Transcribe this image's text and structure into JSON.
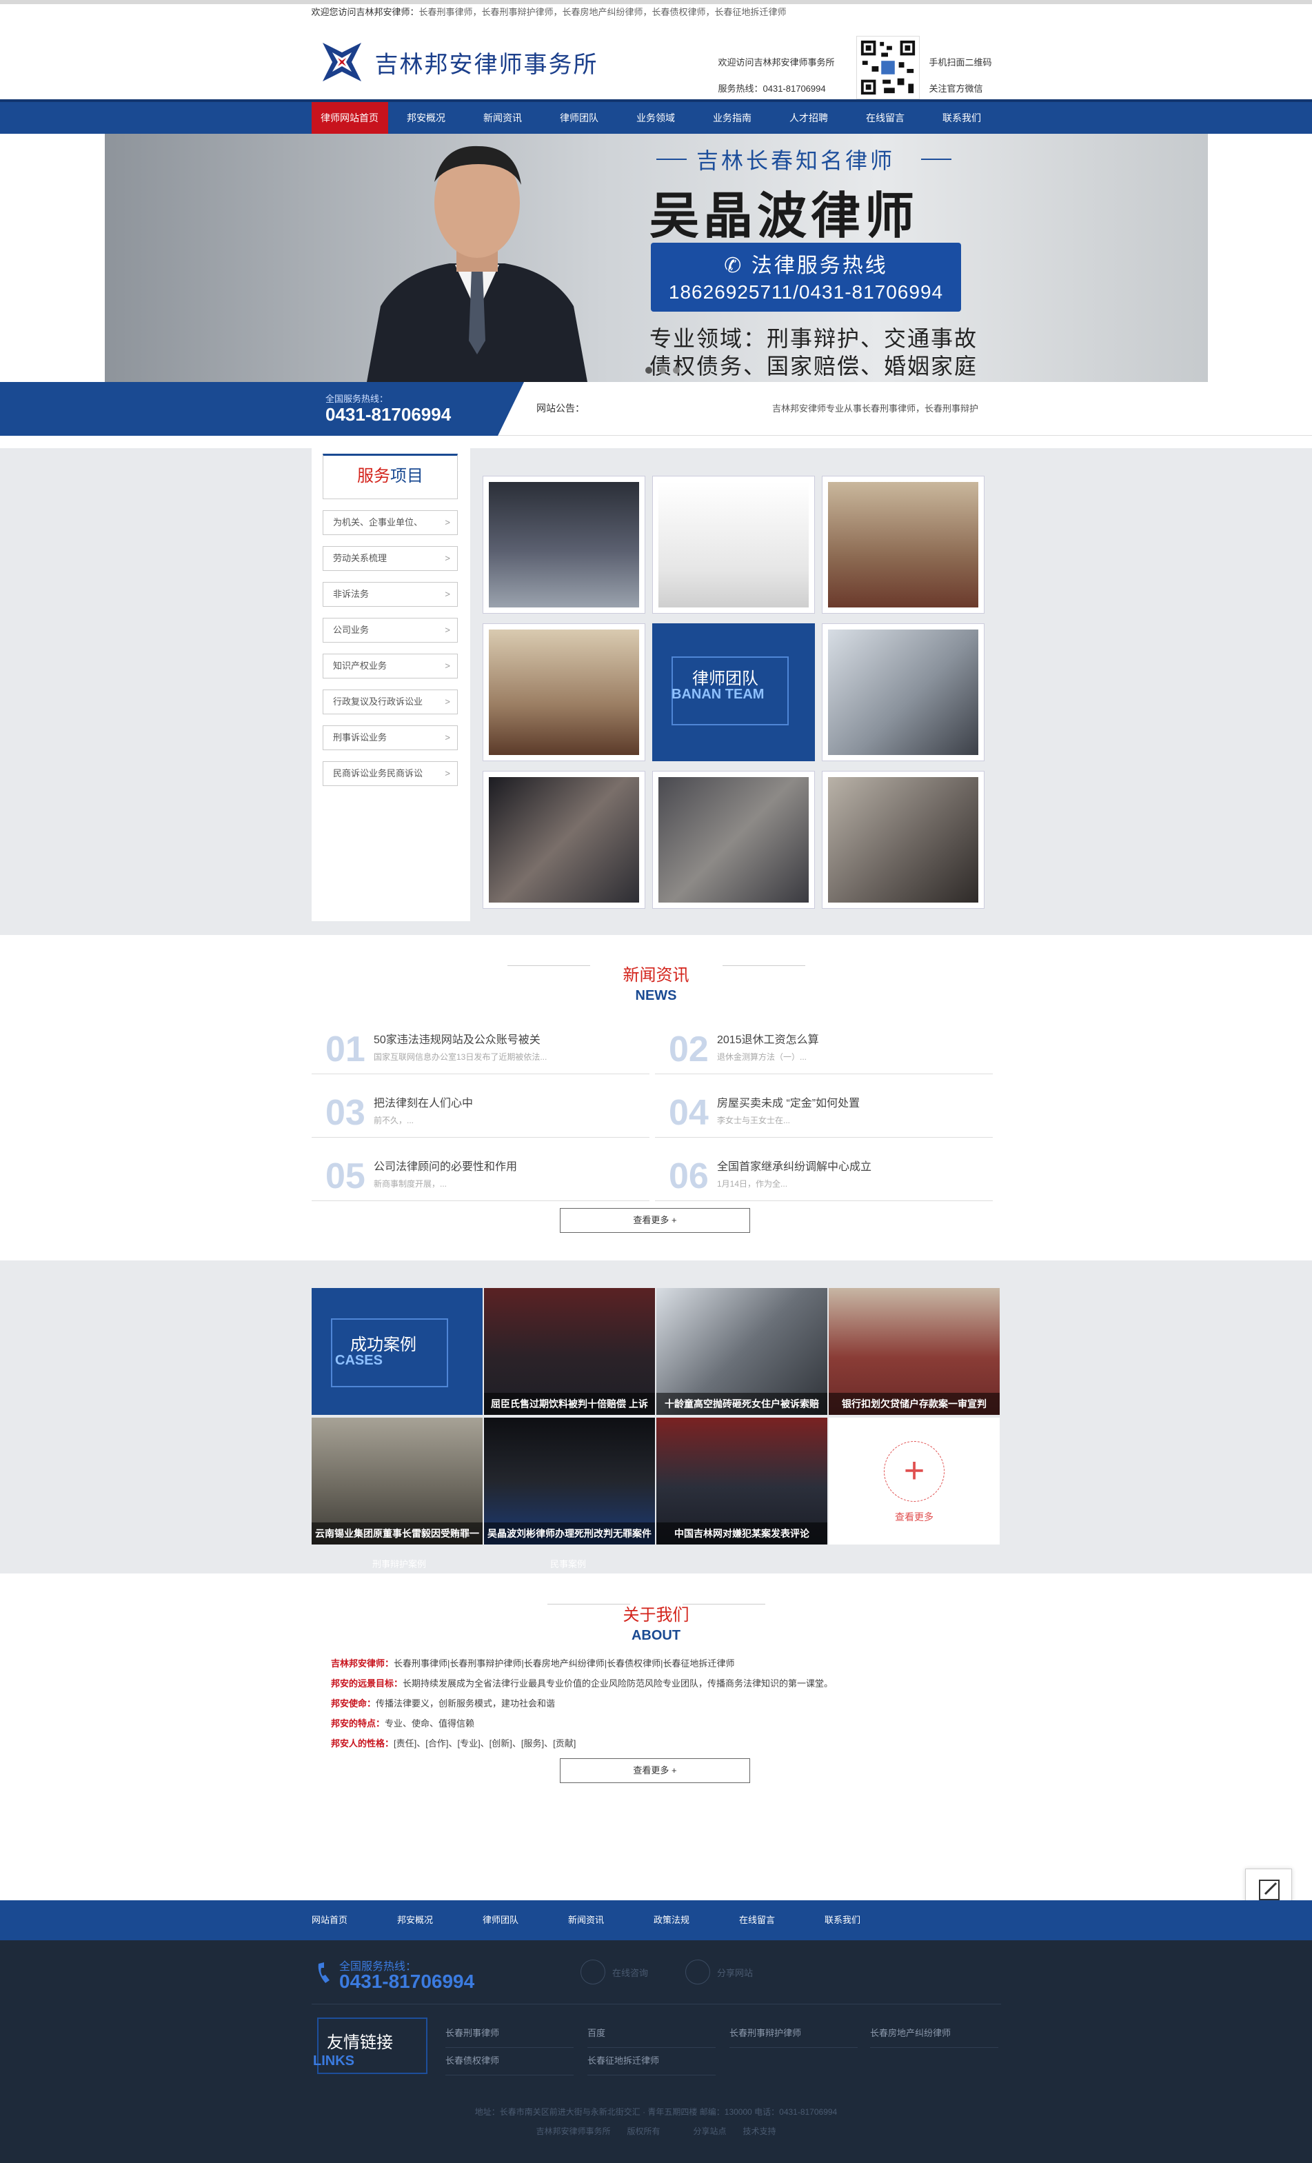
{
  "topbar": {
    "welcome_prefix": "欢迎您访问吉林邦安律师：",
    "welcome_links": "长春刑事律师，长春刑事辩护律师，长春房地产纠纷律师，长春债权律师，长春征地拆迁律师"
  },
  "header": {
    "logo_text": "吉林邦安律师事务所",
    "welcome": "欢迎访问吉林邦安律师事务所",
    "hotline": "服务热线：0431-81706994",
    "qr_scan": "手机扫面二维码",
    "qr_follow": "关注官方微信"
  },
  "nav": {
    "items": [
      {
        "label": "律师网站首页"
      },
      {
        "label": "邦安概况"
      },
      {
        "label": "新闻资讯"
      },
      {
        "label": "律师团队"
      },
      {
        "label": "业务领域"
      },
      {
        "label": "业务指南"
      },
      {
        "label": "人才招聘"
      },
      {
        "label": "在线留言"
      },
      {
        "label": "联系我们"
      }
    ]
  },
  "banner": {
    "subtitle": "吉林长春知名律师",
    "title": "吴晶波律师",
    "hotline_label": "法律服务热线",
    "hotline_number": "18626925711/0431-81706994",
    "area_line1": "专业领域：刑事辩护、交通事故",
    "area_line2": "债权债务、国家赔偿、婚姻家庭"
  },
  "notice": {
    "hotline_label": "全国服务热线：",
    "hotline_number": "0431-81706994",
    "notice_label": "网站公告：",
    "notice_text": "吉林邦安律师专业从事长春刑事律师，长春刑事辩护"
  },
  "services": {
    "title_red": "服务",
    "title_blue": "项目",
    "items": [
      {
        "label": "为机关、企事业单位、"
      },
      {
        "label": "劳动关系梳理"
      },
      {
        "label": "非诉法务"
      },
      {
        "label": "公司业务"
      },
      {
        "label": "知识产权业务"
      },
      {
        "label": "行政复议及行政诉讼业"
      },
      {
        "label": "刑事诉讼业务"
      },
      {
        "label": "民商诉讼业务民商诉讼"
      }
    ],
    "chevron": ">",
    "team_cn": "律师团队",
    "team_en": "BANAN TEAM"
  },
  "news": {
    "title_cn": "新闻资讯",
    "title_en": "NEWS",
    "items": [
      {
        "num": "01",
        "title": "50家违法违规网站及公众账号被关",
        "desc": "国家互联网信息办公室13日发布了近期被依法..."
      },
      {
        "num": "02",
        "title": "2015退休工资怎么算",
        "desc": "退休金测算方法（一）..."
      },
      {
        "num": "03",
        "title": "把法律刻在人们心中",
        "desc": "前不久，..."
      },
      {
        "num": "04",
        "title": "房屋买卖未成 “定金”如何处置",
        "desc": "李女士与王女士在..."
      },
      {
        "num": "05",
        "title": "公司法律顾问的必要性和作用",
        "desc": "新商事制度开展，..."
      },
      {
        "num": "06",
        "title": "全国首家继承纠纷调解中心成立",
        "desc": "1月14日，作为全..."
      }
    ],
    "more": "查看更多",
    "more_plus": "+"
  },
  "cases": {
    "title_cn": "成功案例",
    "title_en": "CASES",
    "items": [
      {
        "caption": "屈臣氏售过期饮料被判十倍赔偿 上诉"
      },
      {
        "caption": "十龄童高空抛砖砸死女住户被诉索赔"
      },
      {
        "caption": "银行扣划欠贷储户存款案一审宣判"
      },
      {
        "caption": "云南锡业集团原董事长雷毅因受贿罪一"
      },
      {
        "caption": "吴晶波刘彬律师办理死刑改判无罪案件"
      },
      {
        "caption": "中国吉林网对嫌犯某案发表评论"
      }
    ],
    "more_plus": "+",
    "more_text": "查看更多",
    "under_left": "刑事辩护案例",
    "under_right": "民事案例"
  },
  "about": {
    "title_cn": "关于我们",
    "title_en": "ABOUT",
    "lines": [
      {
        "label": "吉林邦安律师：",
        "text": "长春刑事律师|长春刑事辩护律师|长春房地产纠纷律师|长春债权律师|长春征地拆迁律师"
      },
      {
        "label": "邦安的远景目标：",
        "text": "长期持续发展成为全省法律行业最具专业价值的企业风险防范风险专业团队，传播商务法律知识的第一课堂。"
      },
      {
        "label": "邦安使命：",
        "text": "传播法律要义，创新服务模式，建功社会和谐"
      },
      {
        "label": "邦安的特点：",
        "text": "专业、使命、值得信赖"
      },
      {
        "label": "邦安人的性格：",
        "text": "[责任]、[合作]、[专业]、[创新]、[服务]、[贡献]"
      }
    ],
    "more": "查看更多",
    "more_plus": "+"
  },
  "footer": {
    "nav": [
      {
        "label": "网站首页"
      },
      {
        "label": "邦安概况"
      },
      {
        "label": "律师团队"
      },
      {
        "label": "新闻资讯"
      },
      {
        "label": "政策法规"
      },
      {
        "label": "在线留言"
      },
      {
        "label": "联系我们"
      }
    ],
    "hotline_label": "全国服务热线：",
    "hotline_number": "0431-81706994",
    "online_consult": "在线咨询",
    "share": "分享网站",
    "links_cn": "友情链接",
    "links_en": "LINKS",
    "links": [
      {
        "label": "长春刑事律师"
      },
      {
        "label": "百度"
      },
      {
        "label": "长春刑事辩护律师"
      },
      {
        "label": "长春房地产纠纷律师"
      },
      {
        "label": "长春债权律师"
      },
      {
        "label": "长春征地拆迁律师"
      }
    ],
    "address": "地址：长春市南关区前进大街与永新北街交汇 · 青年五期四楼 邮编：130000 电话：0431-81706994",
    "bottom_links": "吉林邦安律师事务所　　版权所有　　　　分享站点　　技术支持"
  },
  "colors": {
    "primary": "#1a4a92",
    "accent": "#c8131d",
    "footer_bg": "#1e2a3a"
  },
  "icons": [
    "logo-icon",
    "phone-icon",
    "qr-code-icon",
    "chevron-right-icon",
    "plus-icon",
    "edit-icon",
    "chat-icon",
    "share-icon"
  ]
}
